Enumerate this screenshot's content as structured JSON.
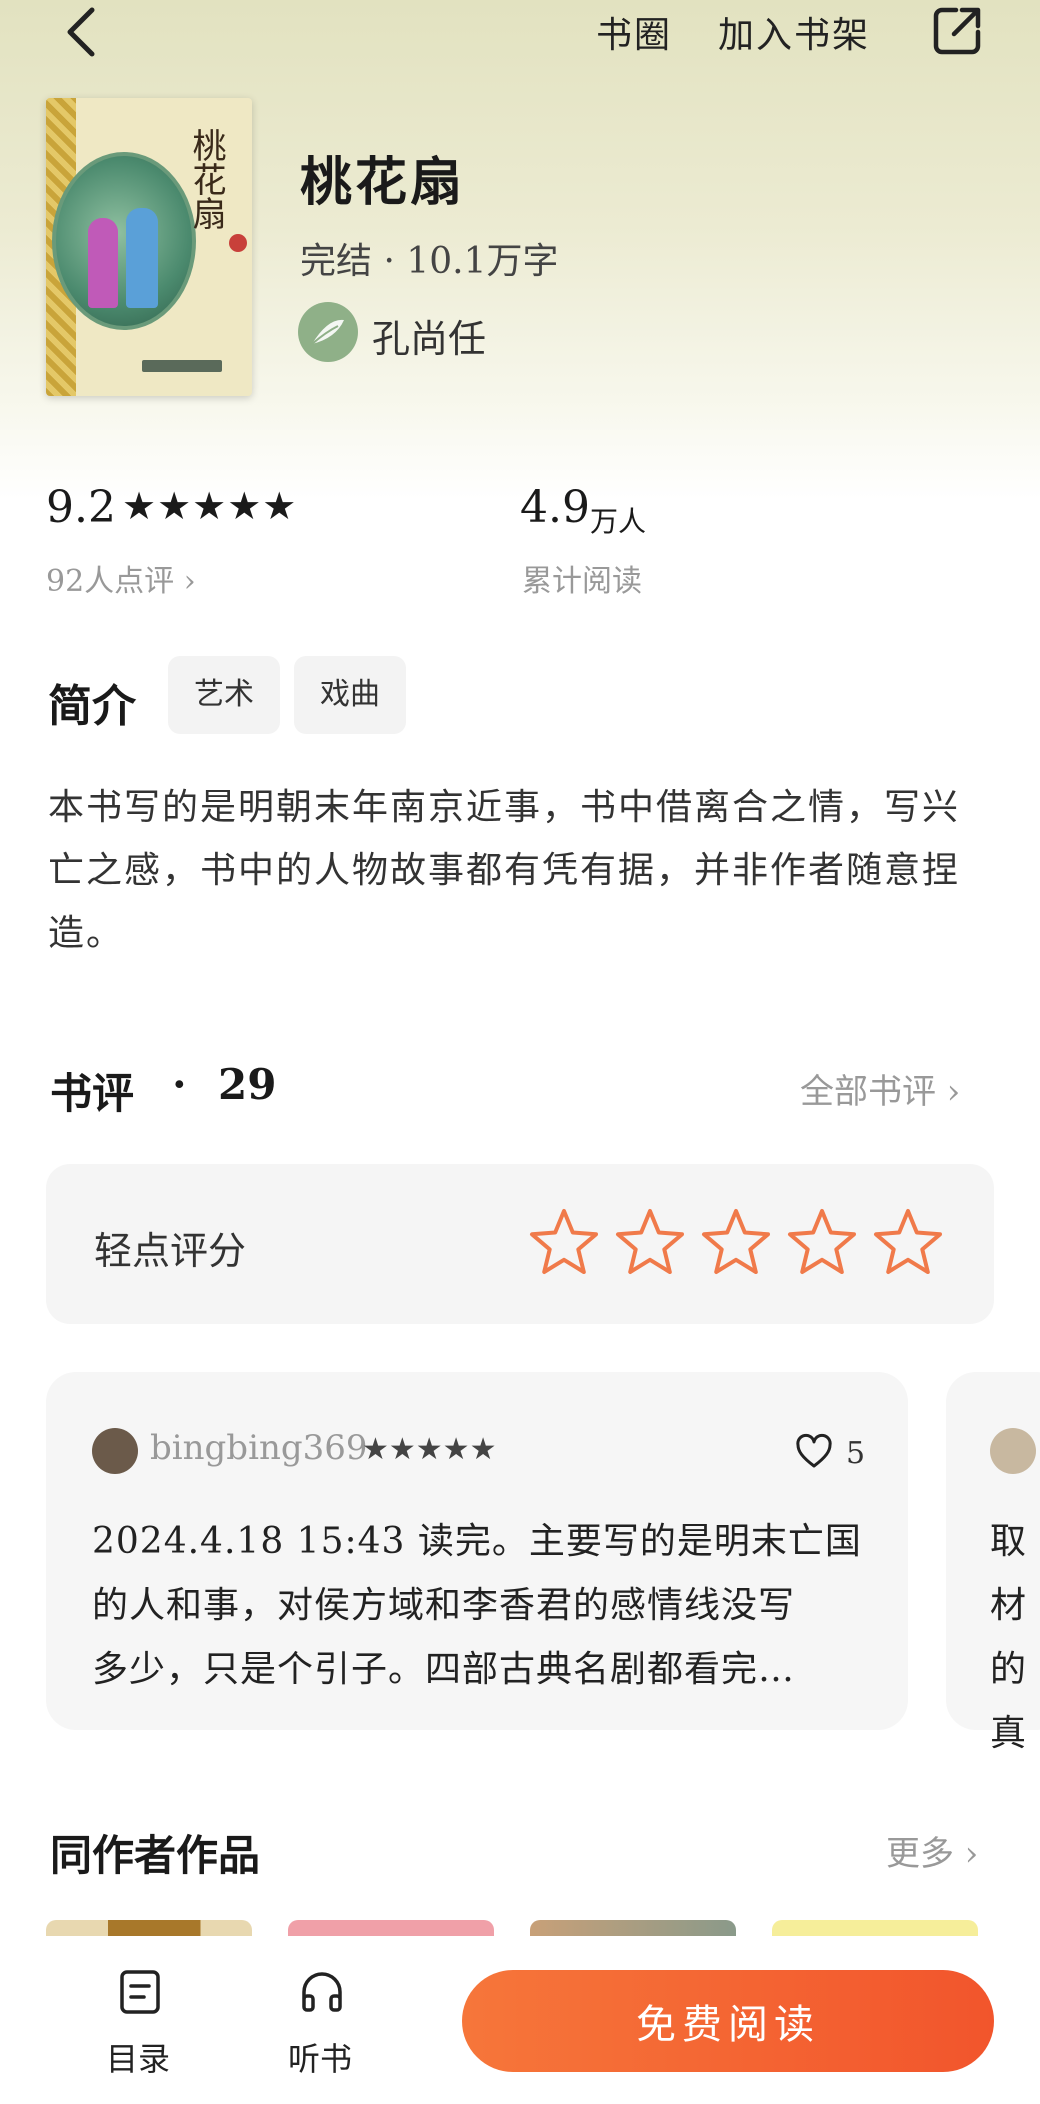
{
  "header": {
    "circle_label": "书圈",
    "add_shelf_label": "加入书架",
    "icons": [
      "back-arrow-icon",
      "share-icon"
    ]
  },
  "book": {
    "title": "桃花扇",
    "meta": "完结 · 10.1万字",
    "author": "孔尚任",
    "rating": "9.2",
    "rating_stars": "★★★★★",
    "reviewers": "92人点评 ›",
    "read_count": "4.9",
    "read_unit": "万人",
    "read_label": "累计阅读"
  },
  "intro": {
    "heading": "简介",
    "tags": [
      "艺术",
      "戏曲"
    ],
    "text": "本书写的是明朝末年南京近事，书中借离合之情，写兴亡之感，书中的人物故事都有凭有据，并非作者随意捏造。"
  },
  "reviews": {
    "heading": "书评",
    "dot": "·",
    "count": "29",
    "all_label": "全部书评 ›",
    "rate_label": "轻点评分",
    "rate_star_count": 5,
    "items": [
      {
        "user": "bingbing369",
        "stars": "★★★★★",
        "likes": "5",
        "text": "2024.4.18 15:43 读完。主要写的是明末亡国\n的人和事，对侯方域和李香君的感情线没写\n多少，只是个引子。四部古典名剧都看完…"
      },
      {
        "text": "取材\n的真"
      }
    ]
  },
  "same_author": {
    "heading": "同作者作品",
    "more_label": "更多 ›"
  },
  "bottom_bar": {
    "toc_label": "目录",
    "listen_label": "听书",
    "read_button": "免费阅读"
  },
  "colors": {
    "accent": "#f2602f",
    "star_outline": "#f07a4a",
    "hero_bg": "#e5e4c6"
  }
}
